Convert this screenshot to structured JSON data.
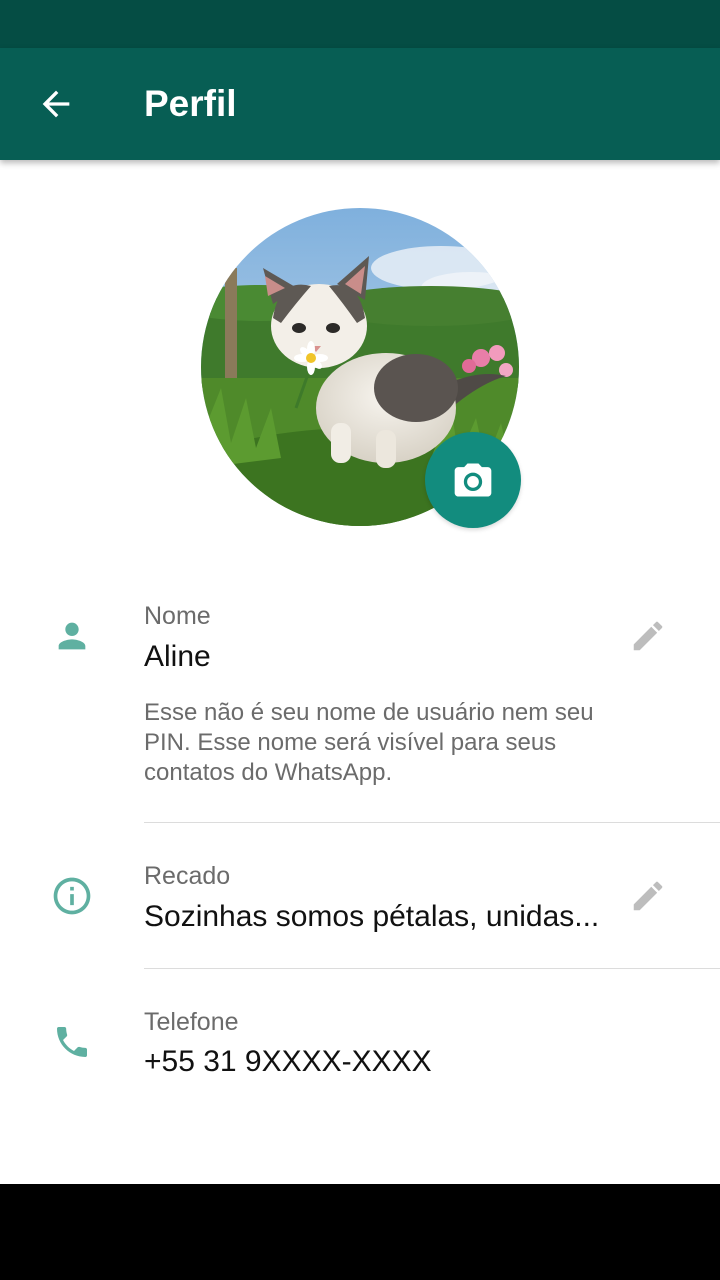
{
  "app_bar": {
    "title": "Perfil",
    "back_icon": "arrow-back-icon"
  },
  "avatar": {
    "description_icon": "profile-photo",
    "camera_icon": "camera-icon"
  },
  "name_section": {
    "icon": "person-icon",
    "label": "Nome",
    "value": "Aline",
    "edit_icon": "pencil-icon",
    "helper": "Esse não é seu nome de usuário nem seu PIN. Esse nome será visível para seus contatos do WhatsApp."
  },
  "about_section": {
    "icon": "info-icon",
    "label": "Recado",
    "value": "Sozinhas somos pétalas, unidas...",
    "edit_icon": "pencil-icon"
  },
  "phone_section": {
    "icon": "phone-icon",
    "label": "Telefone",
    "value": "+55 31 9XXXX-XXXX"
  },
  "colors": {
    "status_bar": "#054d44",
    "app_bar": "#075e54",
    "accent": "#128c7e",
    "icon_teal": "#5fb0a1",
    "nav_bar": "#000000"
  }
}
